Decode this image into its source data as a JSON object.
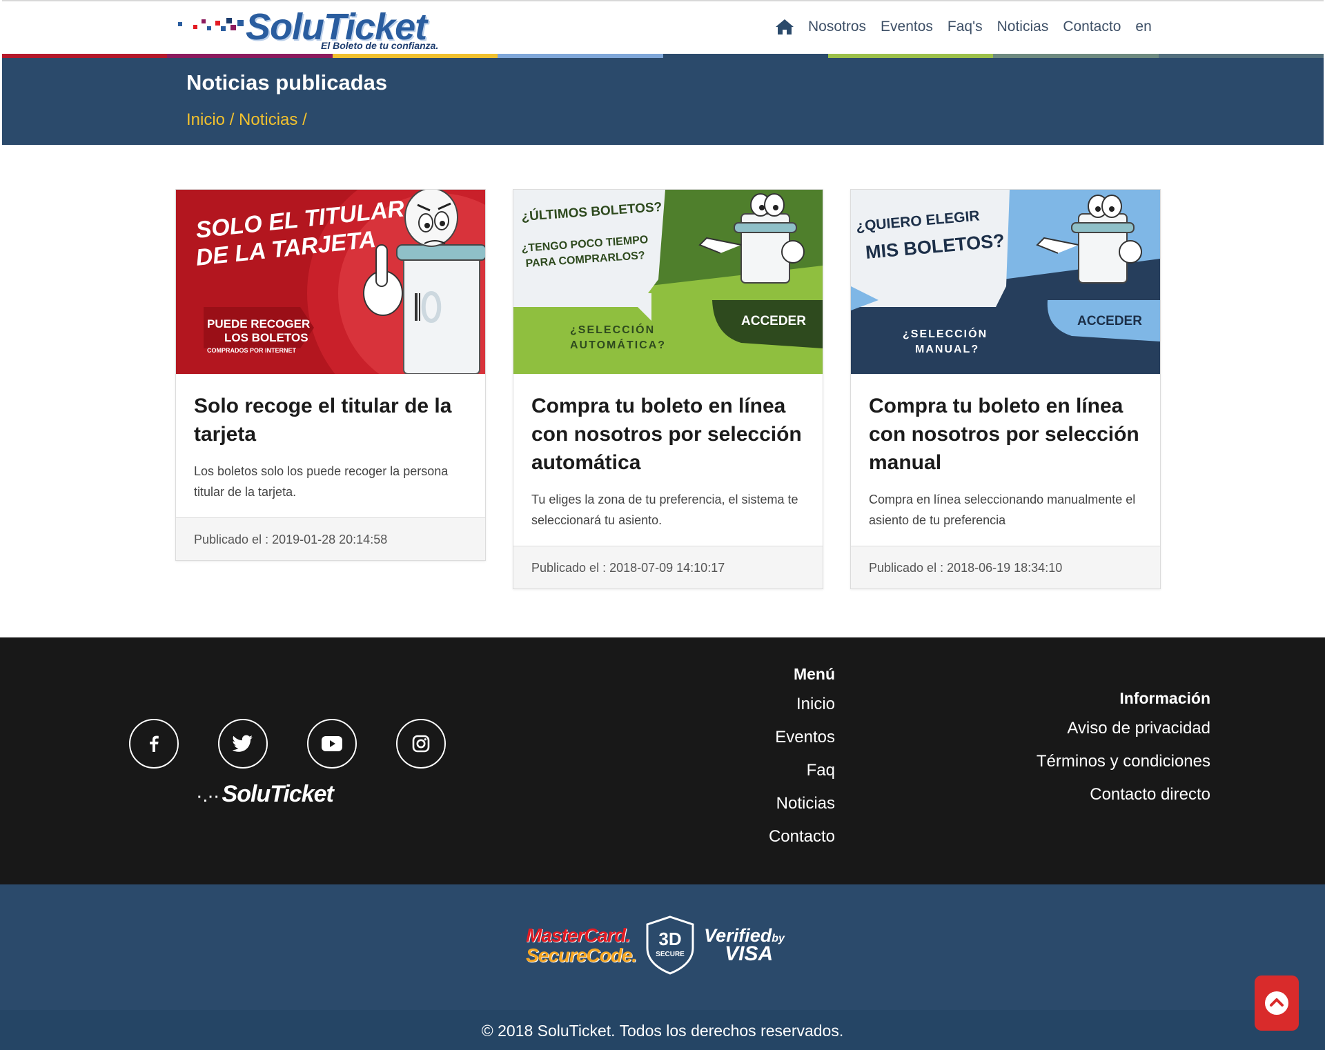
{
  "header": {
    "logo_text": "SoluTicket",
    "logo_tagline": "El Boleto de tu confianza.",
    "nav": [
      "Nosotros",
      "Eventos",
      "Faq's",
      "Noticias",
      "Contacto",
      "en"
    ]
  },
  "stripe_colors": [
    "#b5192b",
    "#8c1b5e",
    "#f0c02e",
    "#7fa7d9",
    "#2b4a6b",
    "#9cc04a",
    "#6e8a80",
    "#54707e"
  ],
  "banner": {
    "title": "Noticias publicadas",
    "crumb_home": "Inicio",
    "crumb_sep": " / ",
    "crumb_section": "Noticias",
    "crumb_tail": " /"
  },
  "cards": [
    {
      "title": "Solo recoge el titular de la tarjeta",
      "text": "Los boletos solo los puede recoger la persona titular de la tarjeta.",
      "published": "Publicado el : 2019-01-28 20:14:58",
      "img": {
        "line1": "SOLO EL TITULAR",
        "line2": "DE LA TARJETA",
        "line3": "PUEDE RECOGER",
        "line4": "LOS BOLETOS",
        "line5": "COMPRADOS POR INTERNET"
      }
    },
    {
      "title": "Compra tu boleto en línea con nosotros por selección automática",
      "text": "Tu eliges la zona de tu preferencia, el sistema te seleccionará tu asiento.",
      "published": "Publicado el : 2018-07-09 14:10:17",
      "img": {
        "q1": "¿ÚLTIMOS BOLETOS?",
        "q2": "¿TENGO POCO TIEMPO",
        "q3": "PARA COMPRARLOS?",
        "q4": "¿SELECCIÓN",
        "q5": "AUTOMÁTICA?",
        "cta": "ACCEDER"
      }
    },
    {
      "title": "Compra tu boleto en línea con nosotros por selección manual",
      "text": "Compra en línea seleccionando manualmente el asiento de tu preferencia",
      "published": "Publicado el : 2018-06-19 18:34:10",
      "img": {
        "q1": "¿QUIERO ELEGIR",
        "q2": "MIS BOLETOS?",
        "q3": "¿SELECCIÓN",
        "q4": "MANUAL?",
        "cta": "ACCEDER"
      }
    }
  ],
  "footer": {
    "logo_text": "SoluTicket",
    "logo_dots": "·.··",
    "social": [
      "facebook-icon",
      "twitter-icon",
      "youtube-icon",
      "instagram-icon"
    ],
    "menu_title": "Menú",
    "menu": [
      "Inicio",
      "Eventos",
      "Faq",
      "Noticias",
      "Contacto"
    ],
    "info_title": "Información",
    "info": [
      "Aviso de privacidad",
      "Términos y condiciones",
      "Contacto directo"
    ]
  },
  "secure": {
    "mc1": "MasterCard.",
    "mc2": "SecureCode.",
    "shield_big": "3D",
    "shield_small": "SECURE",
    "vbv1": "Verified",
    "vbv2": "by",
    "vbv3": "VISA"
  },
  "copyright": "© 2018 SoluTicket. Todos los derechos reservados."
}
